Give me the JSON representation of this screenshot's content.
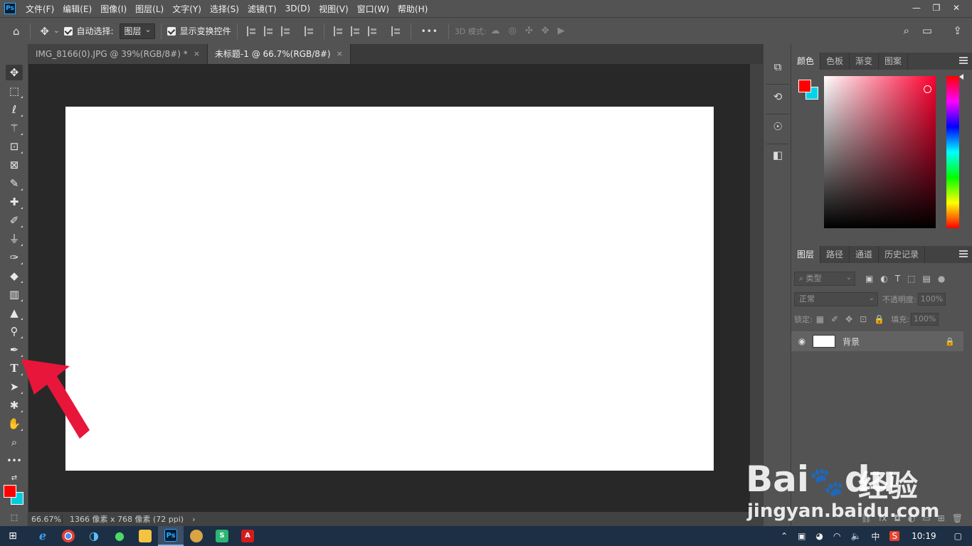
{
  "menubar": {
    "logo": "Ps",
    "items": [
      "文件(F)",
      "编辑(E)",
      "图像(I)",
      "图层(L)",
      "文字(Y)",
      "选择(S)",
      "滤镜(T)",
      "3D(D)",
      "视图(V)",
      "窗口(W)",
      "帮助(H)"
    ],
    "window_controls": [
      "—",
      "❐",
      "✕"
    ]
  },
  "optbar": {
    "auto_select_label": "自动选择:",
    "auto_select_value": "图层",
    "show_transform_label": "显示变换控件",
    "more": "•••",
    "mode_3d": "3D 模式:"
  },
  "tabs": [
    {
      "label": "IMG_8166(0).JPG @ 39%(RGB/8#) *",
      "close": "×"
    },
    {
      "label": "未标题-1 @ 66.7%(RGB/8#)",
      "close": "×"
    }
  ],
  "status": {
    "zoom": "66.67%",
    "doc_info": "1366 像素 x 768 像素 (72 ppi)",
    "arrow": "›"
  },
  "color_panel": {
    "tabs": [
      "颜色",
      "色板",
      "渐变",
      "图案"
    ],
    "foreground": "#ff0000",
    "background": "#00d4e8"
  },
  "layers_panel": {
    "tabs": [
      "图层",
      "路径",
      "通道",
      "历史记录"
    ],
    "filter_placeholder": "类型",
    "blend_mode": "正常",
    "opacity_label": "不透明度:",
    "opacity_value": "100%",
    "lock_label": "锁定:",
    "fill_label": "填充:",
    "fill_value": "100%",
    "layers": [
      {
        "name": "背景"
      }
    ]
  },
  "watermark": {
    "brand": "Bai",
    "brand_du": "du",
    "cn": "经验",
    "url": "jingyan.baidu.com"
  },
  "taskbar": {
    "apps": [
      "ie",
      "chrome",
      "edge",
      "wechat",
      "explorer",
      "photoshop",
      "app7",
      "app8",
      "acrobat"
    ],
    "ps_glyph": "Ps",
    "ime": "中",
    "clock": "10:19"
  },
  "colors": {
    "ui_bg": "#535353",
    "canvas_bg": "#282828",
    "accent_red": "#ff0000",
    "accent_cyan": "#00d4e8",
    "arrow_red": "#e8163a"
  }
}
